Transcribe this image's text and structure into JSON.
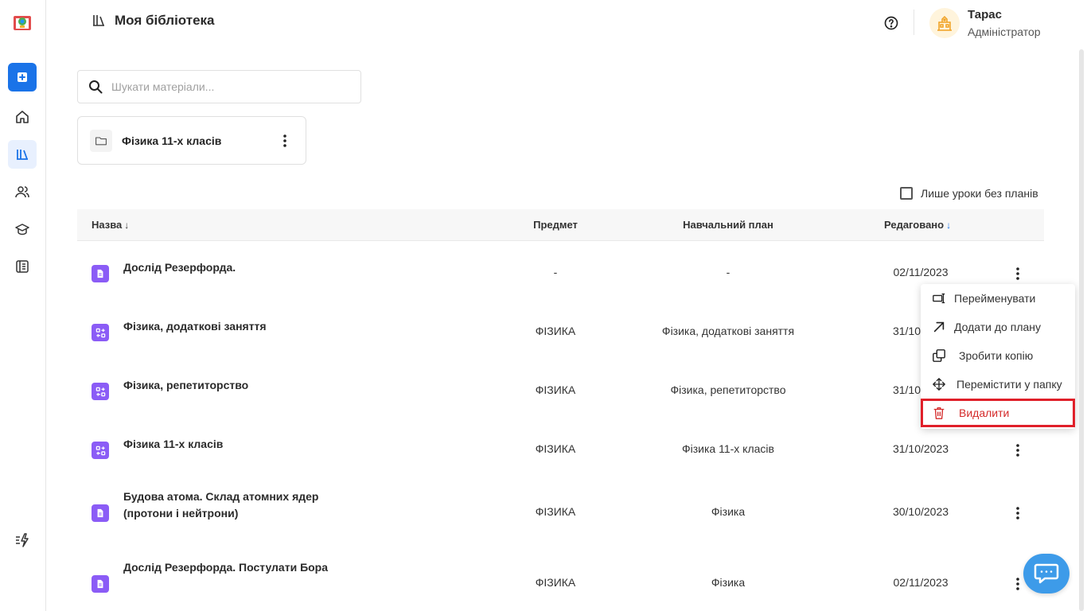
{
  "header": {
    "title": "Моя бібліотека",
    "help_icon": "question-circle-icon"
  },
  "user": {
    "name": "Тарас",
    "role": "Адміністратор",
    "avatar_icon": "school-building-icon"
  },
  "sidebar": {
    "items": [
      {
        "name": "add",
        "icon": "plus-square-icon"
      },
      {
        "name": "home",
        "icon": "home-icon"
      },
      {
        "name": "library",
        "icon": "library-icon",
        "active": true
      },
      {
        "name": "users",
        "icon": "users-icon"
      },
      {
        "name": "courses",
        "icon": "graduation-cap-icon"
      },
      {
        "name": "journal",
        "icon": "book-icon"
      },
      {
        "name": "quick-actions",
        "icon": "quick-actions-icon"
      }
    ]
  },
  "search": {
    "placeholder": "Шукати матеріали..."
  },
  "folder": {
    "name": "Фізика 11-х класів"
  },
  "filter": {
    "label": "Лише уроки без планів",
    "checked": false
  },
  "table": {
    "columns": {
      "name": "Назва",
      "subject": "Предмет",
      "plan": "Навчальний план",
      "edited": "Редаговано"
    },
    "sort_arrow": "↓",
    "rows": [
      {
        "name": "Дослід Резерфорда.",
        "subject": "-",
        "plan": "-",
        "date": "02/11/2023",
        "icon": "document-icon"
      },
      {
        "name": "Фізика, додаткові заняття",
        "subject": "ФІЗИКА",
        "plan": "Фізика, додаткові заняття",
        "date": "31/10/2023",
        "icon": "course-icon"
      },
      {
        "name": "Фізика, репетиторство",
        "subject": "ФІЗИКА",
        "plan": "Фізика, репетиторство",
        "date": "31/10/2023",
        "icon": "course-icon"
      },
      {
        "name": "Фізика 11-х класів",
        "subject": "ФІЗИКА",
        "plan": "Фізика 11-х класів",
        "date": "31/10/2023",
        "icon": "course-icon"
      },
      {
        "name": "Будова атома. Склад атомних ядер (протони і нейтрони)",
        "subject": "ФІЗИКА",
        "plan": "Фізика",
        "date": "30/10/2023",
        "icon": "document-icon"
      },
      {
        "name": "Дослід Резерфорда. Постулати Бора",
        "subject": "ФІЗИКА",
        "plan": "Фізика",
        "date": "02/11/2023",
        "icon": "document-icon"
      }
    ]
  },
  "context_menu": {
    "items": [
      {
        "label": "Перейменувати",
        "icon": "rename-icon"
      },
      {
        "label": "Додати до плану",
        "icon": "arrow-up-right-icon"
      },
      {
        "label": "Зробити копію",
        "icon": "copy-icon"
      },
      {
        "label": "Перемістити у папку",
        "icon": "move-icon"
      },
      {
        "label": "Видалити",
        "icon": "trash-icon",
        "danger": true
      }
    ]
  },
  "chat": {
    "icon": "chat-bubble-icon"
  },
  "colors": {
    "accent": "#1a73e8",
    "item_icon": "#8b5cf6",
    "danger": "#e0202a",
    "chat": "#3d9be9"
  }
}
